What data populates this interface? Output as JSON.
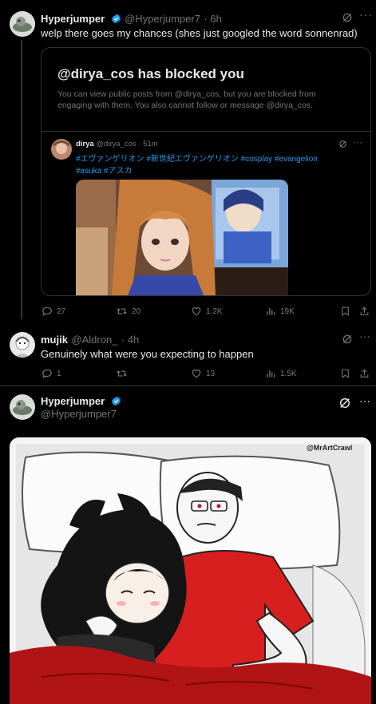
{
  "post1": {
    "name": "Hyperjumper",
    "handle": "@Hyperjumper7",
    "time": "· 6h",
    "text": "welp there goes my chances (shes just googled the word sonnenrad)",
    "blocked_title": "@dirya_cos has blocked you",
    "blocked_body": "You can view public posts from @dirya_cos, but you are blocked from engaging with them. You also cannot follow or message @dirya_cos.",
    "quote": {
      "name": "dirya",
      "handle": "@dirya_cos",
      "time": "· 51m",
      "tags_line1": "#エヴァンゲリオン #新世紀エヴァンゲリオン #cosplay #evangelion",
      "tags_line2": "#asuka #アスカ"
    },
    "replies": "27",
    "reposts": "20",
    "likes": "1.2K",
    "views": "19K"
  },
  "post2": {
    "name": "mujik",
    "handle": "@Aldron_",
    "time": "· 4h",
    "text": "Genuinely what were you expecting to happen",
    "replies": "1",
    "reposts": "",
    "likes": "13",
    "views": "1.5K"
  },
  "post3": {
    "name": "Hyperjumper",
    "handle": "@Hyperjumper7",
    "image_watermark": "@MrArtCrawl"
  },
  "colors": {
    "accent": "#1d9bf0",
    "muted": "#71767b",
    "border": "#2f3336"
  }
}
